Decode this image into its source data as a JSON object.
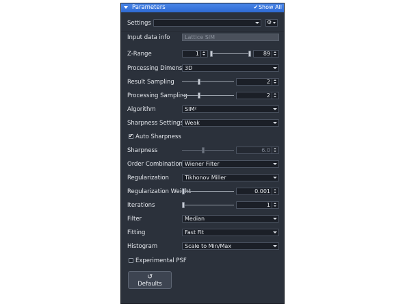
{
  "panel": {
    "title": "Parameters",
    "show_all": "Show All"
  },
  "settings": {
    "label": "Settings",
    "value": ""
  },
  "input_data_info": {
    "label": "Input data info",
    "placeholder": "Lattice SIM"
  },
  "z_range": {
    "label": "Z-Range",
    "min": "1",
    "max": "89",
    "min_fraction": 0.0,
    "max_fraction": 1.0
  },
  "processing_dimension": {
    "label": "Processing Dimension",
    "value": "3D"
  },
  "result_sampling": {
    "label": "Result Sampling",
    "value": "2",
    "fraction": 0.45
  },
  "processing_sampling": {
    "label": "Processing Sampling",
    "value": "2",
    "fraction": 0.45
  },
  "algorithm": {
    "label": "Algorithm",
    "value": "SIM²"
  },
  "sharpness_settings": {
    "label": "Sharpness Settings",
    "value": "Weak"
  },
  "auto_sharpness": {
    "label": "Auto Sharpness",
    "checked": true
  },
  "sharpness": {
    "label": "Sharpness",
    "value": "6.0",
    "fraction": 0.4
  },
  "order_combination": {
    "label": "Order Combination",
    "value": "Wiener Filter"
  },
  "regularization": {
    "label": "Regularization",
    "value": "Tikhonov Miller"
  },
  "regularization_weight": {
    "label": "Regularization Weight",
    "value": "0.001",
    "fraction": 0.0
  },
  "iterations": {
    "label": "Iterations",
    "value": "1",
    "fraction": 0.0
  },
  "filter": {
    "label": "Filter",
    "value": "Median"
  },
  "fitting": {
    "label": "Fitting",
    "value": "Fast Fit"
  },
  "histogram": {
    "label": "Histogram",
    "value": "Scale to Min/Max"
  },
  "experimental_psf": {
    "label": "Experimental PSF",
    "checked": false
  },
  "defaults_button": {
    "label": "Defaults"
  },
  "colors": {
    "titlebar": "#3a78e0",
    "panel": "#2b313b"
  }
}
